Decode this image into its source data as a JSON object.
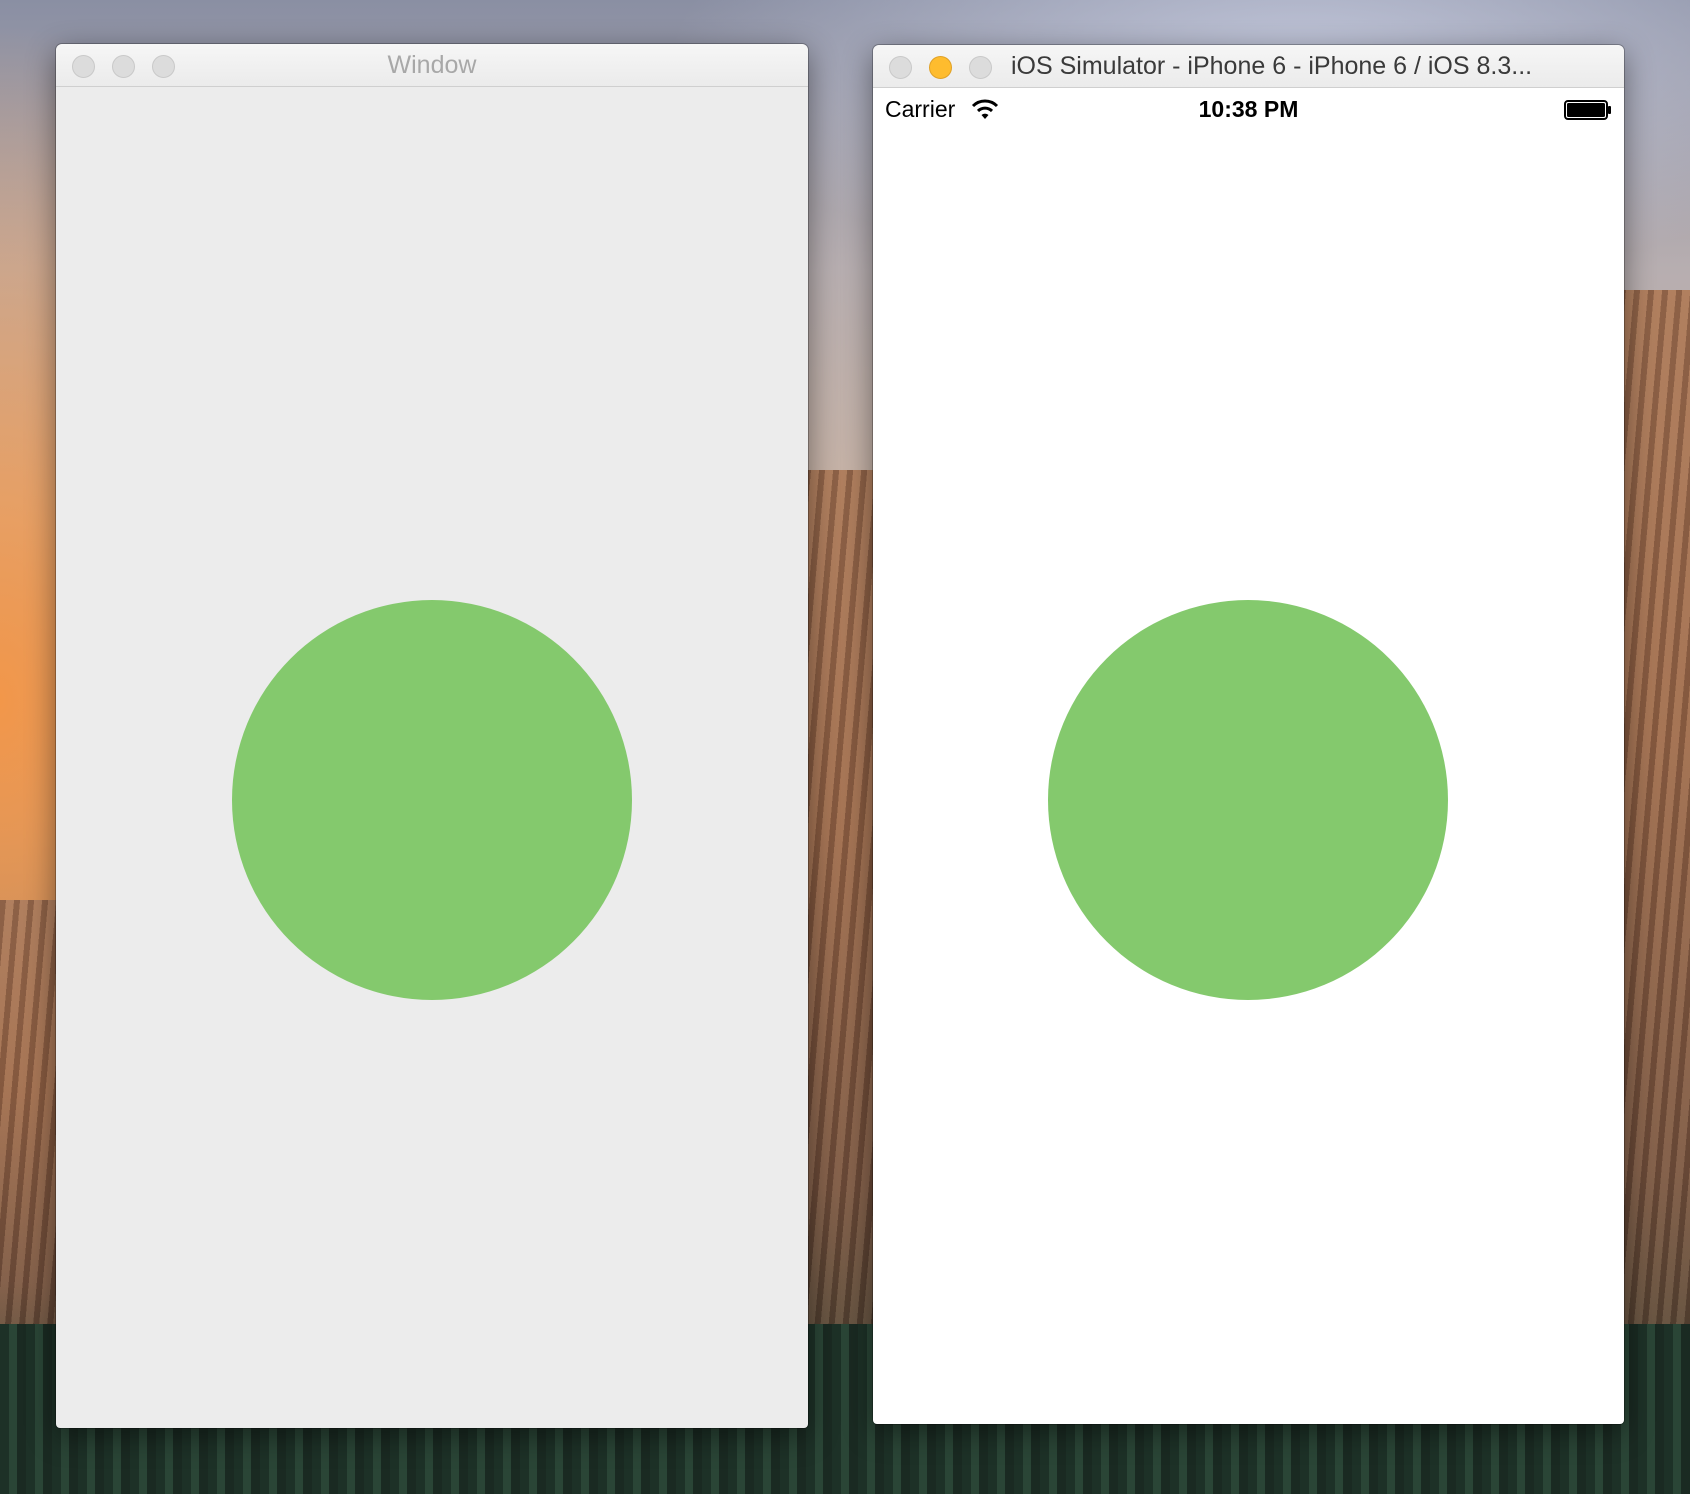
{
  "left_window": {
    "title": "Window",
    "background_color": "#ececec",
    "title_color": "#a8a8a8",
    "circle_color": "#84c96d",
    "traffic_lights": [
      "close-button",
      "minimize-button",
      "zoom-button"
    ]
  },
  "right_window": {
    "title": "iOS Simulator - iPhone 6 - iPhone 6 / iOS 8.3...",
    "background_color": "#ffffff",
    "title_color": "#3a3a3a",
    "circle_color": "#84c96d",
    "status_bar": {
      "carrier": "Carrier",
      "wifi_icon": "wifi-icon",
      "time": "10:38 PM",
      "battery_icon": "battery-icon",
      "battery_level": 1.0
    }
  },
  "desktop": {
    "wallpaper": "yosemite-el-capitan"
  }
}
